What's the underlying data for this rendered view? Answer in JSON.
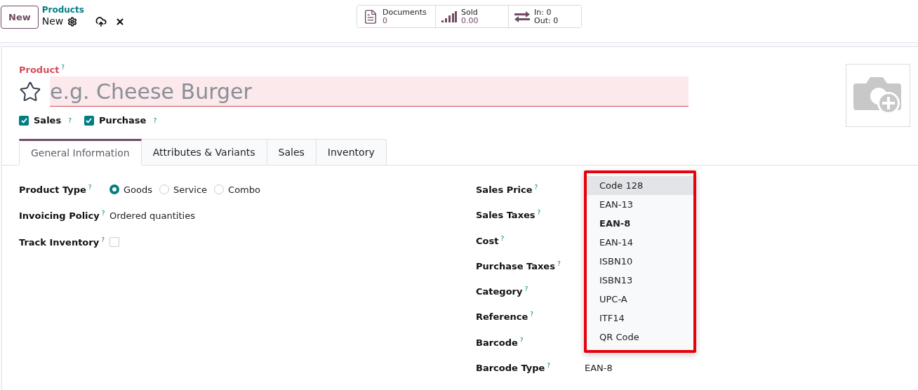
{
  "control_panel": {
    "new_button": "New",
    "breadcrumb": "Products",
    "record": "New"
  },
  "smart_buttons": [
    {
      "kind": "documents",
      "label": "Documents",
      "value": "0"
    },
    {
      "kind": "sold",
      "label": "Sold",
      "value": "0.00"
    },
    {
      "kind": "moves",
      "label": "In: 0",
      "value": "Out: 0"
    }
  ],
  "product": {
    "label": "Product",
    "help": "?",
    "placeholder": "e.g. Cheese Burger",
    "favorite": false
  },
  "options": [
    {
      "label": "Sales",
      "help": "?",
      "checked": true
    },
    {
      "label": "Purchase",
      "help": "?",
      "checked": true
    }
  ],
  "tabs": [
    {
      "label": "General Information",
      "selected": true
    },
    {
      "label": "Attributes & Variants",
      "selected": false
    },
    {
      "label": "Sales",
      "selected": false
    },
    {
      "label": "Inventory",
      "selected": false
    }
  ],
  "left_fields": [
    {
      "kind": "radio",
      "label": "Product Type",
      "help": "?",
      "options": [
        {
          "label": "Goods",
          "selected": true
        },
        {
          "label": "Service",
          "selected": false
        },
        {
          "label": "Combo",
          "selected": false
        }
      ]
    },
    {
      "kind": "text",
      "label": "Invoicing Policy",
      "help": "?",
      "value": "Ordered quantities"
    },
    {
      "kind": "checkbox",
      "label": "Track Inventory",
      "help": "?",
      "checked": false
    }
  ],
  "right_fields": [
    {
      "label": "Sales Price",
      "help": "?"
    },
    {
      "label": "Sales Taxes",
      "help": "?"
    },
    {
      "label": "Cost",
      "help": "?"
    },
    {
      "label": "Purchase Taxes",
      "help": "?"
    },
    {
      "label": "Category",
      "help": "?"
    },
    {
      "label": "Reference",
      "help": "?"
    },
    {
      "label": "Barcode",
      "help": "?"
    },
    {
      "label": "Barcode Type",
      "help": "?",
      "value": "EAN-8"
    }
  ],
  "dropdown": {
    "items": [
      {
        "label": "Code 128",
        "hovered": true,
        "selected": false
      },
      {
        "label": "EAN-13",
        "hovered": false,
        "selected": false
      },
      {
        "label": "EAN-8",
        "hovered": false,
        "selected": true
      },
      {
        "label": "EAN-14",
        "hovered": false,
        "selected": false
      },
      {
        "label": "ISBN10",
        "hovered": false,
        "selected": false
      },
      {
        "label": "ISBN13",
        "hovered": false,
        "selected": false
      },
      {
        "label": "UPC-A",
        "hovered": false,
        "selected": false
      },
      {
        "label": "ITF14",
        "hovered": false,
        "selected": false
      },
      {
        "label": "QR Code",
        "hovered": false,
        "selected": false
      }
    ]
  }
}
